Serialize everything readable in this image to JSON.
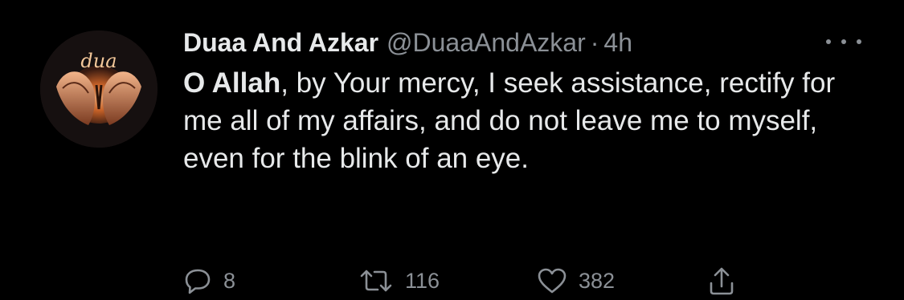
{
  "tweet": {
    "display_name": "Duaa And Azkar",
    "handle": "@DuaaAndAzkar",
    "separator": "·",
    "time": "4h",
    "avatar_text": "dua",
    "body_bold": "O Allah",
    "body_rest": ", by Your mercy, I seek assistance, rectify for me all of my affairs, and do not leave me to myself, even for the blink of an eye.",
    "actions": {
      "reply": {
        "icon": "reply-icon",
        "count": "8"
      },
      "retweet": {
        "icon": "retweet-icon",
        "count": "116"
      },
      "like": {
        "icon": "heart-icon",
        "count": "382"
      },
      "share": {
        "icon": "share-icon"
      }
    }
  },
  "colors": {
    "background": "#000000",
    "primary_text": "#e7e9ea",
    "secondary_text": "#8b9096"
  }
}
